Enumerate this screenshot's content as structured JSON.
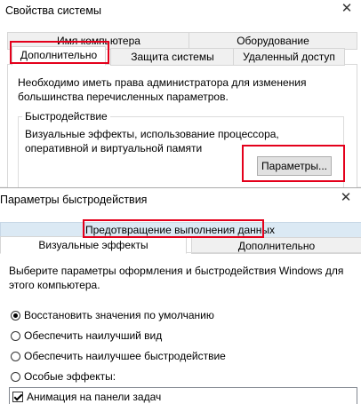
{
  "system_properties": {
    "title": "Свойства системы",
    "tabs_back": [
      "Имя компьютера",
      "Оборудование"
    ],
    "tabs_front": [
      "Дополнительно",
      "Защита системы",
      "Удаленный доступ"
    ],
    "info_text": "Необходимо иметь права администратора для изменения большинства перечисленных параметров.",
    "performance_group": {
      "caption": "Быстродействие",
      "description": "Визуальные эффекты, использование процессора, оперативной и виртуальной памяти",
      "button_label": "Параметры..."
    }
  },
  "performance_options": {
    "title": "Параметры быстродействия",
    "tabs_back": [
      "Предотвращение выполнения данных"
    ],
    "tabs_front": [
      "Визуальные эффекты",
      "Дополнительно"
    ],
    "description": "Выберите параметры оформления и быстродействия Windows для этого компьютера.",
    "radio_options": [
      {
        "label": "Восстановить значения по умолчанию",
        "checked": true
      },
      {
        "label": "Обеспечить наилучший вид",
        "checked": false
      },
      {
        "label": "Обеспечить наилучшее быстродействие",
        "checked": false
      },
      {
        "label": "Особые эффекты:",
        "checked": false
      }
    ],
    "effects": [
      {
        "label": "Анимация на панели задач",
        "checked": true
      }
    ]
  },
  "colors": {
    "highlight": "#e4001b",
    "window_bg": "#ffffff",
    "tab_bg": "#f0f0f0"
  },
  "icons": {
    "close": "close-icon"
  }
}
